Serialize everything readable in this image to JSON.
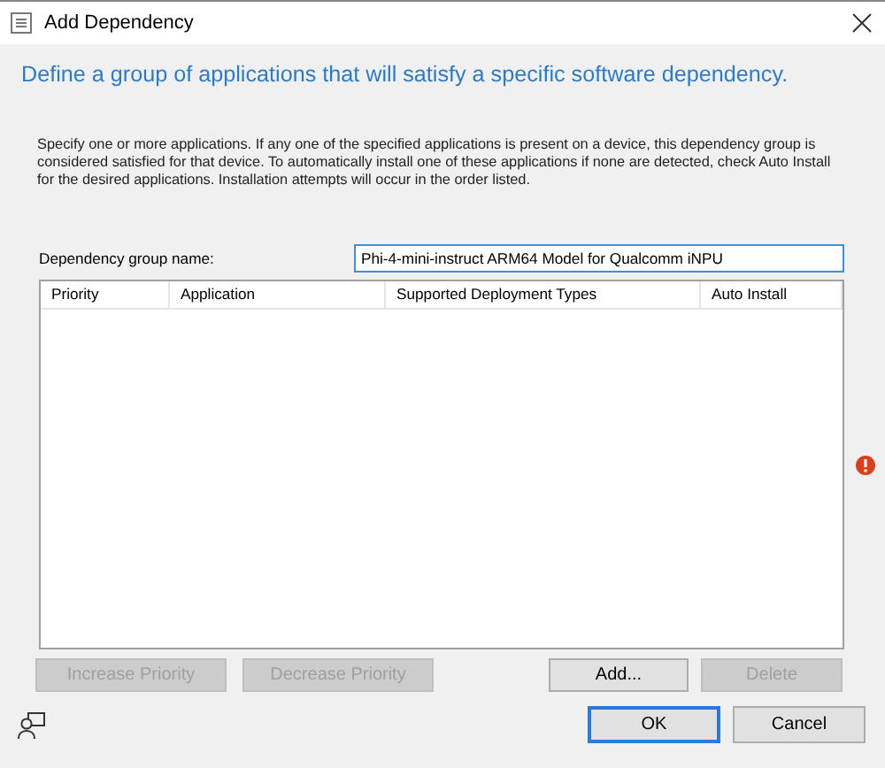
{
  "window": {
    "title": "Add Dependency"
  },
  "heading": "Define a group of applications that will satisfy a specific software dependency.",
  "description": "Specify one or more applications. If any one of the specified applications is present on a device, this dependency group is considered satisfied for that device. To automatically install one of these applications if none are detected, check Auto Install for the desired applications. Installation attempts will occur in the order listed.",
  "group_name": {
    "label": "Dependency group name:",
    "value": "Phi-4-mini-instruct ARM64 Model for Qualcomm iNPU"
  },
  "table": {
    "columns": [
      "Priority",
      "Application",
      "Supported Deployment Types",
      "Auto Install"
    ]
  },
  "list_buttons": [
    {
      "label": "Increase Priority",
      "disabled": true
    },
    {
      "label": "Decrease Priority",
      "disabled": true
    },
    {
      "label": "Add...",
      "disabled": false
    },
    {
      "label": "Delete",
      "disabled": true
    }
  ],
  "dialog_buttons": [
    {
      "label": "OK",
      "default": true
    },
    {
      "label": "Cancel",
      "default": false
    }
  ]
}
